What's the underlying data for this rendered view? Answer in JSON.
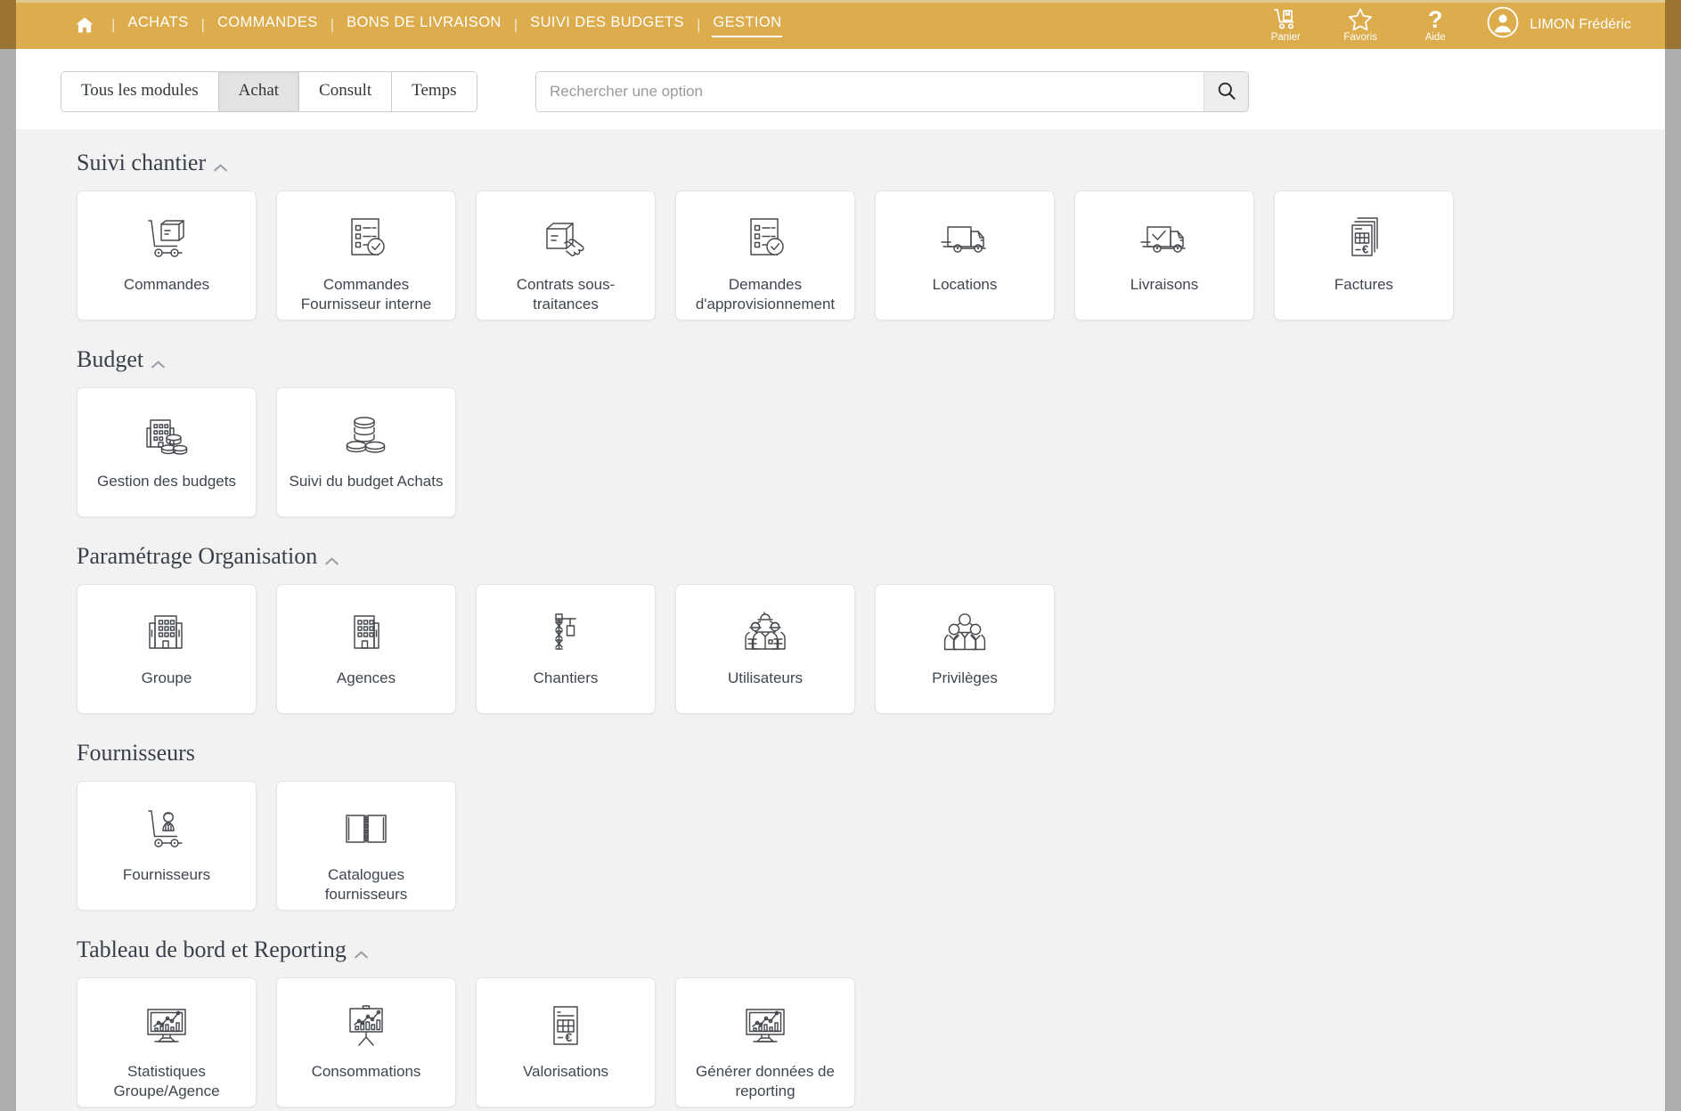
{
  "theme": {
    "header_bg": "#dcac4d",
    "header_cap": "#9a7430",
    "page_bg": "#f2f2f2",
    "card_bg": "#ffffff",
    "text": "#3f4650",
    "frame": "#adadad"
  },
  "header": {
    "home_icon": "home-icon",
    "separator": "|",
    "nav": [
      {
        "label": "ACHATS",
        "active": false
      },
      {
        "label": "COMMANDES",
        "active": false
      },
      {
        "label": "BONS DE LIVRAISON",
        "active": false
      },
      {
        "label": "SUIVI DES BUDGETS",
        "active": false
      },
      {
        "label": "GESTION",
        "active": true
      }
    ],
    "actions": [
      {
        "label": "Panier",
        "icon": "cart-trolley-icon"
      },
      {
        "label": "Favoris",
        "icon": "star-icon"
      },
      {
        "label": "Aide",
        "icon": "question-mark-icon"
      }
    ],
    "user": {
      "name": "LIMON Frédéric",
      "icon": "user-avatar-icon"
    }
  },
  "subbar": {
    "tabs": [
      {
        "label": "Tous les modules",
        "active": false
      },
      {
        "label": "Achat",
        "active": true
      },
      {
        "label": "Consult",
        "active": false
      },
      {
        "label": "Temps",
        "active": false
      }
    ],
    "search": {
      "value": "",
      "placeholder": "Rechercher une option",
      "button_icon": "search-icon"
    }
  },
  "sections": [
    {
      "title": "Suivi chantier",
      "collapsible": true,
      "chevron": "chevron-up-icon",
      "cards": [
        {
          "label": "Commandes",
          "icon": "trolley-box-icon"
        },
        {
          "label": "Commandes Fournisseur interne",
          "icon": "checklist-box-check-icon"
        },
        {
          "label": "Contrats sous-traitances",
          "icon": "box-handshake-icon"
        },
        {
          "label": "Demandes d'approvisionnement",
          "icon": "checklist-box-check-icon"
        },
        {
          "label": "Locations",
          "icon": "truck-icon"
        },
        {
          "label": "Livraisons",
          "icon": "truck-check-icon"
        },
        {
          "label": "Factures",
          "icon": "invoice-stack-euro-icon"
        }
      ]
    },
    {
      "title": "Budget",
      "collapsible": true,
      "chevron": "chevron-up-icon",
      "cards": [
        {
          "label": "Gestion des budgets",
          "icon": "building-coins-icon"
        },
        {
          "label": "Suivi du budget Achats",
          "icon": "coins-stack-icon"
        }
      ]
    },
    {
      "title": "Paramétrage Organisation",
      "collapsible": true,
      "chevron": "chevron-up-icon",
      "cards": [
        {
          "label": "Groupe",
          "icon": "buildings-icon"
        },
        {
          "label": "Agences",
          "icon": "building-icon"
        },
        {
          "label": "Chantiers",
          "icon": "crane-icon"
        },
        {
          "label": "Utilisateurs",
          "icon": "workers-helmet-icon"
        },
        {
          "label": "Privilèges",
          "icon": "people-suit-icon"
        }
      ]
    },
    {
      "title": "Fournisseurs",
      "collapsible": false,
      "chevron": "",
      "cards": [
        {
          "label": "Fournisseurs",
          "icon": "trolley-person-icon"
        },
        {
          "label": "Catalogues fournisseurs",
          "icon": "open-book-icon"
        }
      ]
    },
    {
      "title": "Tableau de bord et Reporting",
      "collapsible": true,
      "chevron": "chevron-up-icon",
      "cards": [
        {
          "label": "Statistiques Groupe/Agence",
          "icon": "monitor-chart-icon"
        },
        {
          "label": "Consommations",
          "icon": "easel-chart-icon"
        },
        {
          "label": "Valorisations",
          "icon": "invoice-euro-icon"
        },
        {
          "label": "Générer données de reporting",
          "icon": "monitor-chart-icon"
        }
      ]
    }
  ]
}
